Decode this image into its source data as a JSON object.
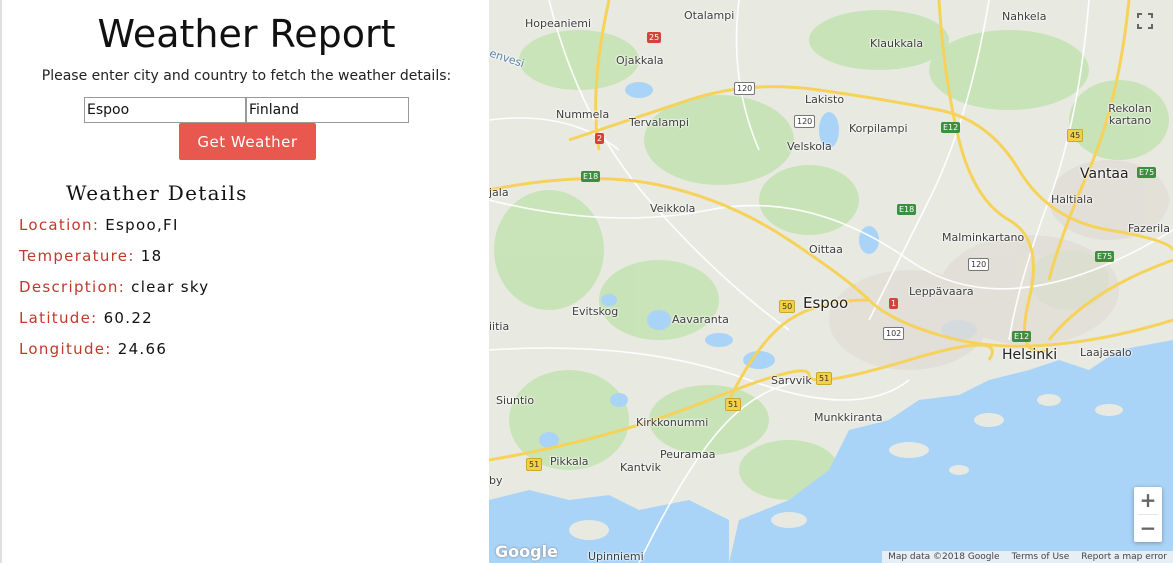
{
  "header": {
    "title": "Weather Report",
    "instructions": "Please enter city and country to fetch the weather details:"
  },
  "form": {
    "city_value": "Espoo",
    "country_value": "Finland",
    "button_label": "Get Weather"
  },
  "details": {
    "heading": "Weather Details",
    "rows": [
      {
        "label": "Location:",
        "value": "Espoo,FI"
      },
      {
        "label": "Temperature:",
        "value": "18"
      },
      {
        "label": "Description:",
        "value": "clear sky"
      },
      {
        "label": "Latitude:",
        "value": "60.22"
      },
      {
        "label": "Longitude:",
        "value": "24.66"
      }
    ]
  },
  "map": {
    "places": {
      "hopeaniemi": "Hopeaniemi",
      "otalampi": "Otalampi",
      "nahkela": "Nahkela",
      "klaukkala": "Klaukkala",
      "ojakkala": "Ojakkala",
      "nummela": "Nummela",
      "tervalampi": "Tervalampi",
      "lakisto": "Lakisto",
      "korpilampi": "Korpilampi",
      "rekolan_kartano": "Rekolan kartano",
      "velskola": "Velskola",
      "vantaa": "Vantaa",
      "haltiala": "Haltiala",
      "veikkola": "Veikkola",
      "jala": "jala",
      "oittaa": "Oittaa",
      "malminkartano": "Malminkartano",
      "fazerila": "Fazerila",
      "leppavaara": "Leppävaara",
      "espoo": "Espoo",
      "evitskog": "Evitskog",
      "aavaranta": "Aavaranta",
      "itia": "iitia",
      "helsinki": "Helsinki",
      "laajasalo": "Laajasalo",
      "sarvvik": "Sarvvik",
      "siuntio": "Siuntio",
      "munkkiranta": "Munkkiranta",
      "kirkkonummi": "Kirkkonummi",
      "pikkala": "Pikkala",
      "peuramaa": "Peuramaa",
      "kantvik": "Kantvik",
      "by": "by",
      "upinniemi": "Upinniemi",
      "envesi": "envesi"
    },
    "shields": {
      "r25": "25",
      "r120a": "120",
      "r120b": "120",
      "r120c": "120",
      "r2": "2",
      "e12a": "E12",
      "e12b": "E12",
      "r45": "45",
      "e75a": "E75",
      "e75b": "E75",
      "e18a": "E18",
      "e18b": "E18",
      "r50": "50",
      "r1": "1",
      "r102": "102",
      "r51a": "51",
      "r51b": "51",
      "r51c": "51"
    },
    "zoom_in": "+",
    "zoom_out": "−",
    "google_logo": "Google",
    "attribution": {
      "map_data": "Map data ©2018 Google",
      "terms": "Terms of Use",
      "report": "Report a map error"
    },
    "colors": {
      "land": "#e8eae2",
      "forest": "#c5e3b4",
      "water": "#a9d3f7",
      "road_major": "#f6d25a",
      "road_minor": "#ffffff"
    }
  }
}
